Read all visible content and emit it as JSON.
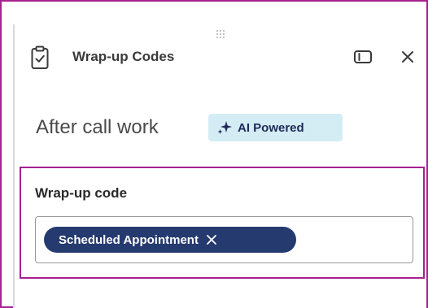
{
  "header": {
    "title": "Wrap-up Codes",
    "icons": {
      "leading": "clipboard-check-icon",
      "drag": "drag-handle-icon",
      "panel": "panel-toggle-icon",
      "close": "close-icon"
    }
  },
  "section": {
    "title": "After call work",
    "badge": {
      "label": "AI Powered",
      "icon": "sparkle-icon",
      "background": "#d4edf5",
      "text_color": "#1f2a5a"
    }
  },
  "field": {
    "label": "Wrap-up code",
    "chips": [
      {
        "label": "Scheduled Appointment",
        "remove_icon": "close-icon"
      }
    ]
  },
  "colors": {
    "highlight": "#a6218f",
    "chip": "#253a6e",
    "text": "#3a3a3a"
  }
}
